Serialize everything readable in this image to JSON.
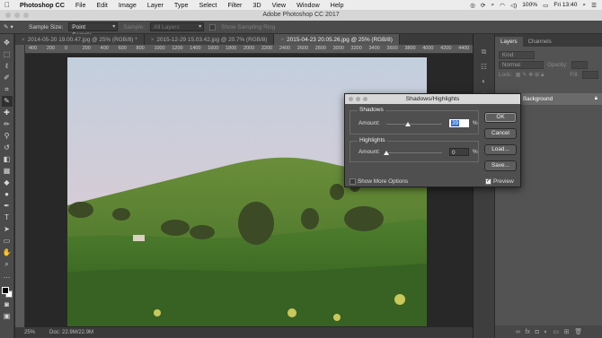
{
  "menubar": {
    "apple": "",
    "items": [
      "Photoshop CC",
      "File",
      "Edit",
      "Image",
      "Layer",
      "Type",
      "Select",
      "Filter",
      "3D",
      "View",
      "Window",
      "Help"
    ],
    "battery": "100%",
    "clock": "Fri 13:40"
  },
  "window": {
    "title": "Adobe Photoshop CC 2017"
  },
  "options": {
    "sample_size_label": "Sample Size:",
    "sample_size_value": "Point Sample",
    "sample_label": "Sample:",
    "sample_value": "All Layers",
    "show_ring": "Show Sampling Ring"
  },
  "tabs": [
    {
      "label": "2014-05-20 19.00.47.jpg @ 25% (RGB/8) *",
      "active": false
    },
    {
      "label": "2015-12-29 15.03.42.jpg @ 20.7% (RGB/8)",
      "active": false
    },
    {
      "label": "2015-04-23 20.05.26.jpg @ 25% (RGB/8)",
      "active": true
    }
  ],
  "ruler": [
    "400",
    "200",
    "0",
    "200",
    "400",
    "600",
    "800",
    "1000",
    "1200",
    "1400",
    "1600",
    "1800",
    "2000",
    "2200",
    "2400",
    "2600",
    "2800",
    "3000",
    "3200",
    "3400",
    "3600",
    "3800",
    "4000",
    "4200",
    "4400"
  ],
  "status": {
    "zoom": "25%",
    "doc": "Doc: 22.9M/22.9M"
  },
  "panel": {
    "tabs": [
      "Layers",
      "Channels"
    ],
    "kind": "Kind",
    "blend": "Normal",
    "opacity_label": "Opacity:",
    "lock_label": "Lock:",
    "fill_label": "Fill:",
    "layer_name": "Background"
  },
  "dialog": {
    "title": "Shadows/Highlights",
    "shadows_label": "Shadows",
    "highlights_label": "Highlights",
    "amount_label": "Amount:",
    "shadows_amount": "39",
    "highlights_amount": "0",
    "pct": "%",
    "shadows_slider_fraction": 0.39,
    "highlights_slider_fraction": 0.0,
    "show_more": "Show More Options",
    "preview": "Preview",
    "buttons": {
      "ok": "OK",
      "cancel": "Cancel",
      "load": "Load...",
      "save": "Save..."
    }
  }
}
